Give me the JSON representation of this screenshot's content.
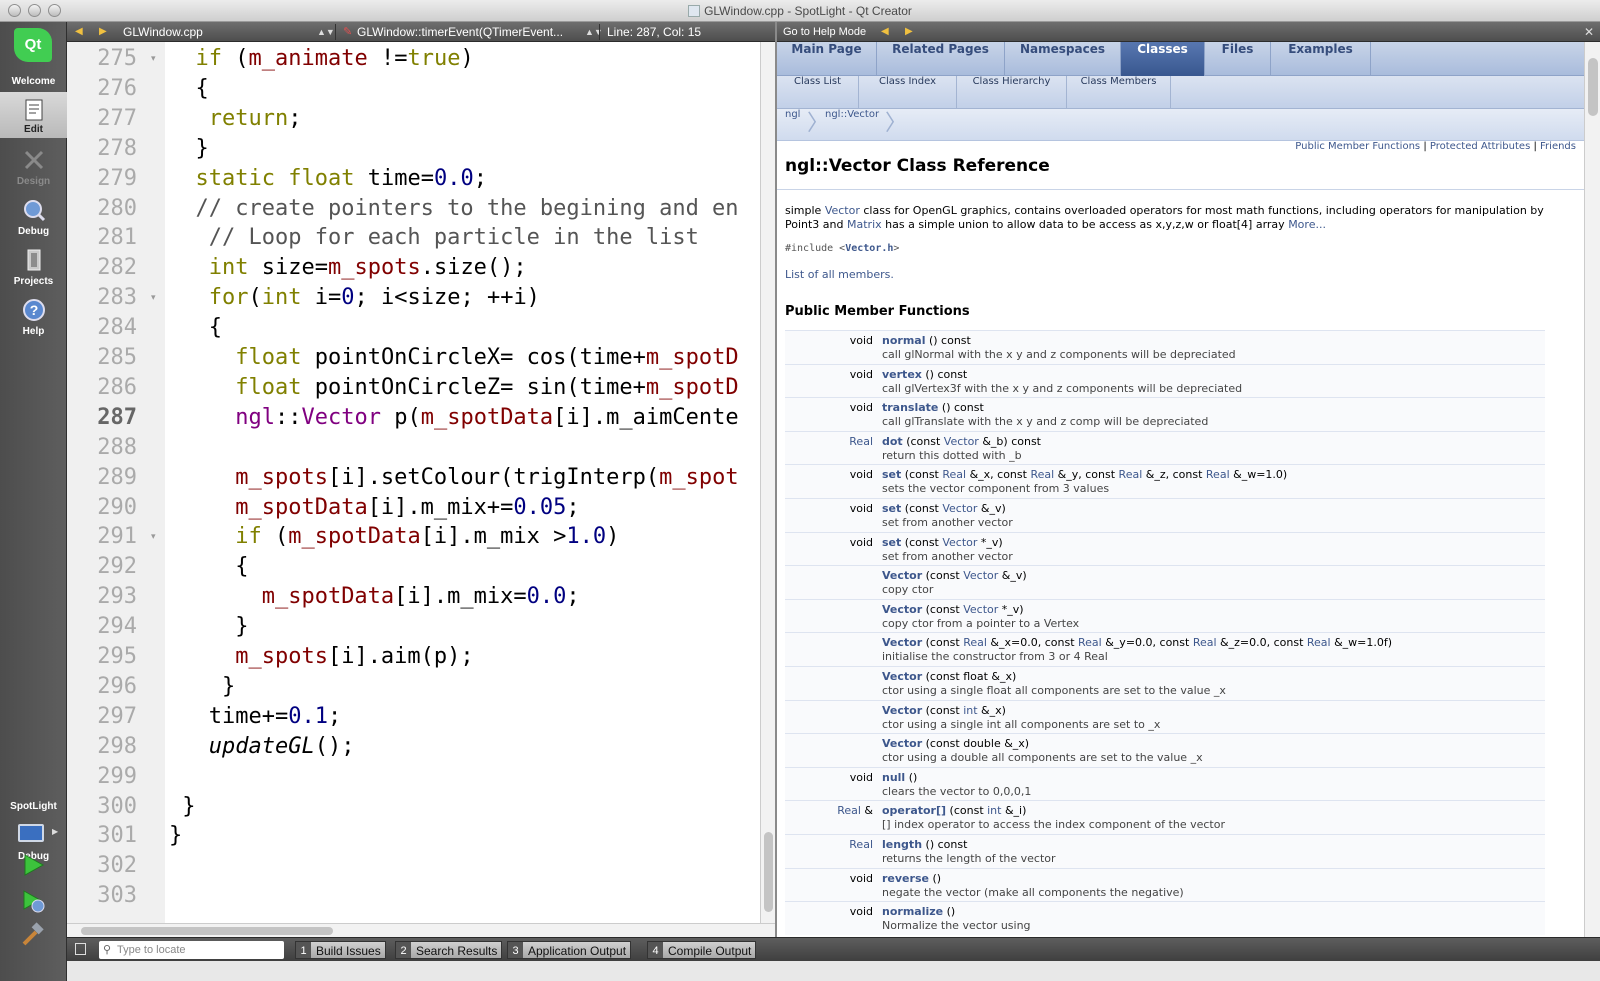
{
  "window": {
    "title": "GLWindow.cpp - SpotLight - Qt Creator"
  },
  "modes": [
    {
      "label": "Welcome"
    },
    {
      "label": "Edit"
    },
    {
      "label": "Design"
    },
    {
      "label": "Debug"
    },
    {
      "label": "Projects"
    },
    {
      "label": "Help"
    }
  ],
  "qt_logo": "Qt",
  "kit": {
    "project": "SpotLight",
    "mode": "Debug"
  },
  "editor": {
    "file": "GLWindow.cpp",
    "function": "GLWindow::timerEvent(QTimerEvent...",
    "position": "Line: 287, Col: 15",
    "current_line": 287,
    "lines": [
      {
        "n": "275",
        "html": "  <span class=\"kw\">if</span> (<span class=\"mem\">m_animate</span> !=<span class=\"kw\">true</span>)",
        "fold": true
      },
      {
        "n": "276",
        "html": "  {"
      },
      {
        "n": "277",
        "html": "   <span class=\"kw\">return</span>;"
      },
      {
        "n": "278",
        "html": "  }"
      },
      {
        "n": "279",
        "html": "  <span class=\"kw\">static</span> <span class=\"ty\">float</span> time=<span class=\"num\">0.0</span>;"
      },
      {
        "n": "280",
        "html": "  <span class=\"cm\">// create pointers to the begining and en</span>"
      },
      {
        "n": "281",
        "html": "   <span class=\"cm\">// Loop for each particle in the list</span>"
      },
      {
        "n": "282",
        "html": "   <span class=\"ty\">int</span> size=<span class=\"mem\">m_spots</span>.size();"
      },
      {
        "n": "283",
        "html": "   <span class=\"kw\">for</span>(<span class=\"ty\">int</span> i=<span class=\"num\">0</span>; i&lt;size; ++i)",
        "fold": true
      },
      {
        "n": "284",
        "html": "   {"
      },
      {
        "n": "285",
        "html": "     <span class=\"ty\">float</span> pointOnCircleX= cos(time+<span class=\"mem\">m_spotD</span>"
      },
      {
        "n": "286",
        "html": "     <span class=\"ty\">float</span> pointOnCircleZ= sin(time+<span class=\"mem\">m_spotD</span>"
      },
      {
        "n": "287",
        "html": "     <span class=\"ns\">ngl</span>::<span class=\"ns\">Vector</span> p(<span class=\"mem\">m_spotData</span>[i].m_aimCente"
      },
      {
        "n": "288",
        "html": ""
      },
      {
        "n": "289",
        "html": "     <span class=\"mem\">m_spots</span>[i].setColour(trigInterp(<span class=\"mem\">m_spot</span>"
      },
      {
        "n": "290",
        "html": "     <span class=\"mem\">m_spotData</span>[i].m_mix+=<span class=\"num\">0.05</span>;"
      },
      {
        "n": "291",
        "html": "     <span class=\"kw\">if</span> (<span class=\"mem\">m_spotData</span>[i].m_mix &gt;<span class=\"num\">1.0</span>)",
        "fold": true
      },
      {
        "n": "292",
        "html": "     {"
      },
      {
        "n": "293",
        "html": "       <span class=\"mem\">m_spotData</span>[i].m_mix=<span class=\"num\">0.0</span>;"
      },
      {
        "n": "294",
        "html": "     }"
      },
      {
        "n": "295",
        "html": "     <span class=\"mem\">m_spots</span>[i].aim(p);"
      },
      {
        "n": "296",
        "html": "    }"
      },
      {
        "n": "297",
        "html": "   time+=<span class=\"num\">0.1</span>;"
      },
      {
        "n": "298",
        "html": "   <span class=\"it\">updateGL</span>();"
      },
      {
        "n": "299",
        "html": ""
      },
      {
        "n": "300",
        "html": " }"
      },
      {
        "n": "301",
        "html": "}"
      },
      {
        "n": "302",
        "html": ""
      },
      {
        "n": "303",
        "html": ""
      }
    ]
  },
  "help": {
    "toolbar_label": "Go to Help Mode",
    "tabs1": [
      "Main Page",
      "Related Pages",
      "Namespaces",
      "Classes",
      "Files",
      "Examples"
    ],
    "tabs1_selected": "Classes",
    "tabs2": [
      "Class List",
      "Class Index",
      "Class Hierarchy",
      "Class Members"
    ],
    "breadcrumbs": [
      "ngl",
      "ngl::Vector"
    ],
    "summary": [
      "Public Member Functions",
      "Protected Attributes",
      "Friends"
    ],
    "heading": "ngl::Vector Class Reference",
    "brief_html": "simple <span class=\"lnk\">Vector</span> class for OpenGL graphics, contains overloaded operators for most math functions, including operators for manipulation by Point3 and <span class=\"lnk\">Matrix</span> has a simple union to allow data to be access as x,y,z,w or float[4] array <span class=\"lnk\">More...</span>",
    "include_pre": "#include <",
    "include_file": "Vector.h",
    "include_post": ">",
    "all_members": "List of all members.",
    "pmf_title": "Public Member Functions",
    "members": [
      {
        "ret": "void",
        "sig": "<span class=\"mname\">normal</span> () const",
        "desc": "call glNormal with the x y and z components will be depreciated"
      },
      {
        "ret": "void",
        "sig": "<span class=\"mname\">vertex</span> () const",
        "desc": "call glVertex3f with the x y and z components will be depreciated"
      },
      {
        "ret": "void",
        "sig": "<span class=\"mname\">translate</span> () const",
        "desc": "call glTranslate with the x y and z comp will be depreciated"
      },
      {
        "ret": "<span class=\"lnk\">Real</span>",
        "sig": "<span class=\"mname\">dot</span> (const <span class=\"lnk\">Vector</span> &amp;_b) const",
        "desc": "return this dotted with _b"
      },
      {
        "ret": "void",
        "sig": "<span class=\"mname\">set</span> (const <span class=\"lnk\">Real</span> &amp;_x, const <span class=\"lnk\">Real</span> &amp;_y, const <span class=\"lnk\">Real</span> &amp;_z, const <span class=\"lnk\">Real</span> &amp;_w=1.0)",
        "desc": "sets the vector component from 3 values"
      },
      {
        "ret": "void",
        "sig": "<span class=\"mname\">set</span> (const <span class=\"lnk\">Vector</span> &amp;_v)",
        "desc": "set from another vector"
      },
      {
        "ret": "void",
        "sig": "<span class=\"mname\">set</span> (const <span class=\"lnk\">Vector</span> *_v)",
        "desc": "set from another vector"
      },
      {
        "ret": "",
        "sig": "<span class=\"mname\">Vector</span> (const <span class=\"lnk\">Vector</span> &amp;_v)",
        "desc": "copy ctor"
      },
      {
        "ret": "",
        "sig": "<span class=\"mname\">Vector</span> (const <span class=\"lnk\">Vector</span> *_v)",
        "desc": "copy ctor from a pointer to a Vertex"
      },
      {
        "ret": "",
        "sig": "<span class=\"mname\">Vector</span> (const <span class=\"lnk\">Real</span> &amp;_x=0.0, const <span class=\"lnk\">Real</span> &amp;_y=0.0, const <span class=\"lnk\">Real</span> &amp;_z=0.0, const <span class=\"lnk\">Real</span> &amp;_w=1.0f)",
        "desc": "initialise the constructor from 3 or 4 Real"
      },
      {
        "ret": "",
        "sig": "<span class=\"mname\">Vector</span> (const float &amp;_x)",
        "desc": "ctor using a single float all components are set to the value _x"
      },
      {
        "ret": "",
        "sig": "<span class=\"mname\">Vector</span> (const <span class=\"lnk\">int</span> &amp;_x)",
        "desc": "ctor using a single int all components are set to _x"
      },
      {
        "ret": "",
        "sig": "<span class=\"mname\">Vector</span> (const double &amp;_x)",
        "desc": "ctor using a double all components are set to the value _x"
      },
      {
        "ret": "void",
        "sig": "<span class=\"mname\">null</span> ()",
        "desc": "clears the vector to 0,0,0,1"
      },
      {
        "ret": "<span class=\"lnk\">Real</span> &amp;",
        "sig": "<span class=\"mname\">operator[]</span> (const <span class=\"lnk\">int</span> &amp;_i)",
        "desc": "[] index operator to access the index component of the vector"
      },
      {
        "ret": "<span class=\"lnk\">Real</span>",
        "sig": "<span class=\"mname\">length</span> () const",
        "desc": "returns the length of the vector"
      },
      {
        "ret": "void",
        "sig": "<span class=\"mname\">reverse</span> ()",
        "desc": "negate the vector (make all components the negative)"
      },
      {
        "ret": "void",
        "sig": "<span class=\"mname\">normalize</span> ()",
        "desc": "Normalize the vector using"
      }
    ]
  },
  "status": {
    "locator_placeholder": "Type to locate",
    "panes": [
      {
        "num": "1",
        "label": "Build Issues"
      },
      {
        "num": "2",
        "label": "Search Results"
      },
      {
        "num": "3",
        "label": "Application Output"
      },
      {
        "num": "4",
        "label": "Compile Output"
      }
    ]
  }
}
